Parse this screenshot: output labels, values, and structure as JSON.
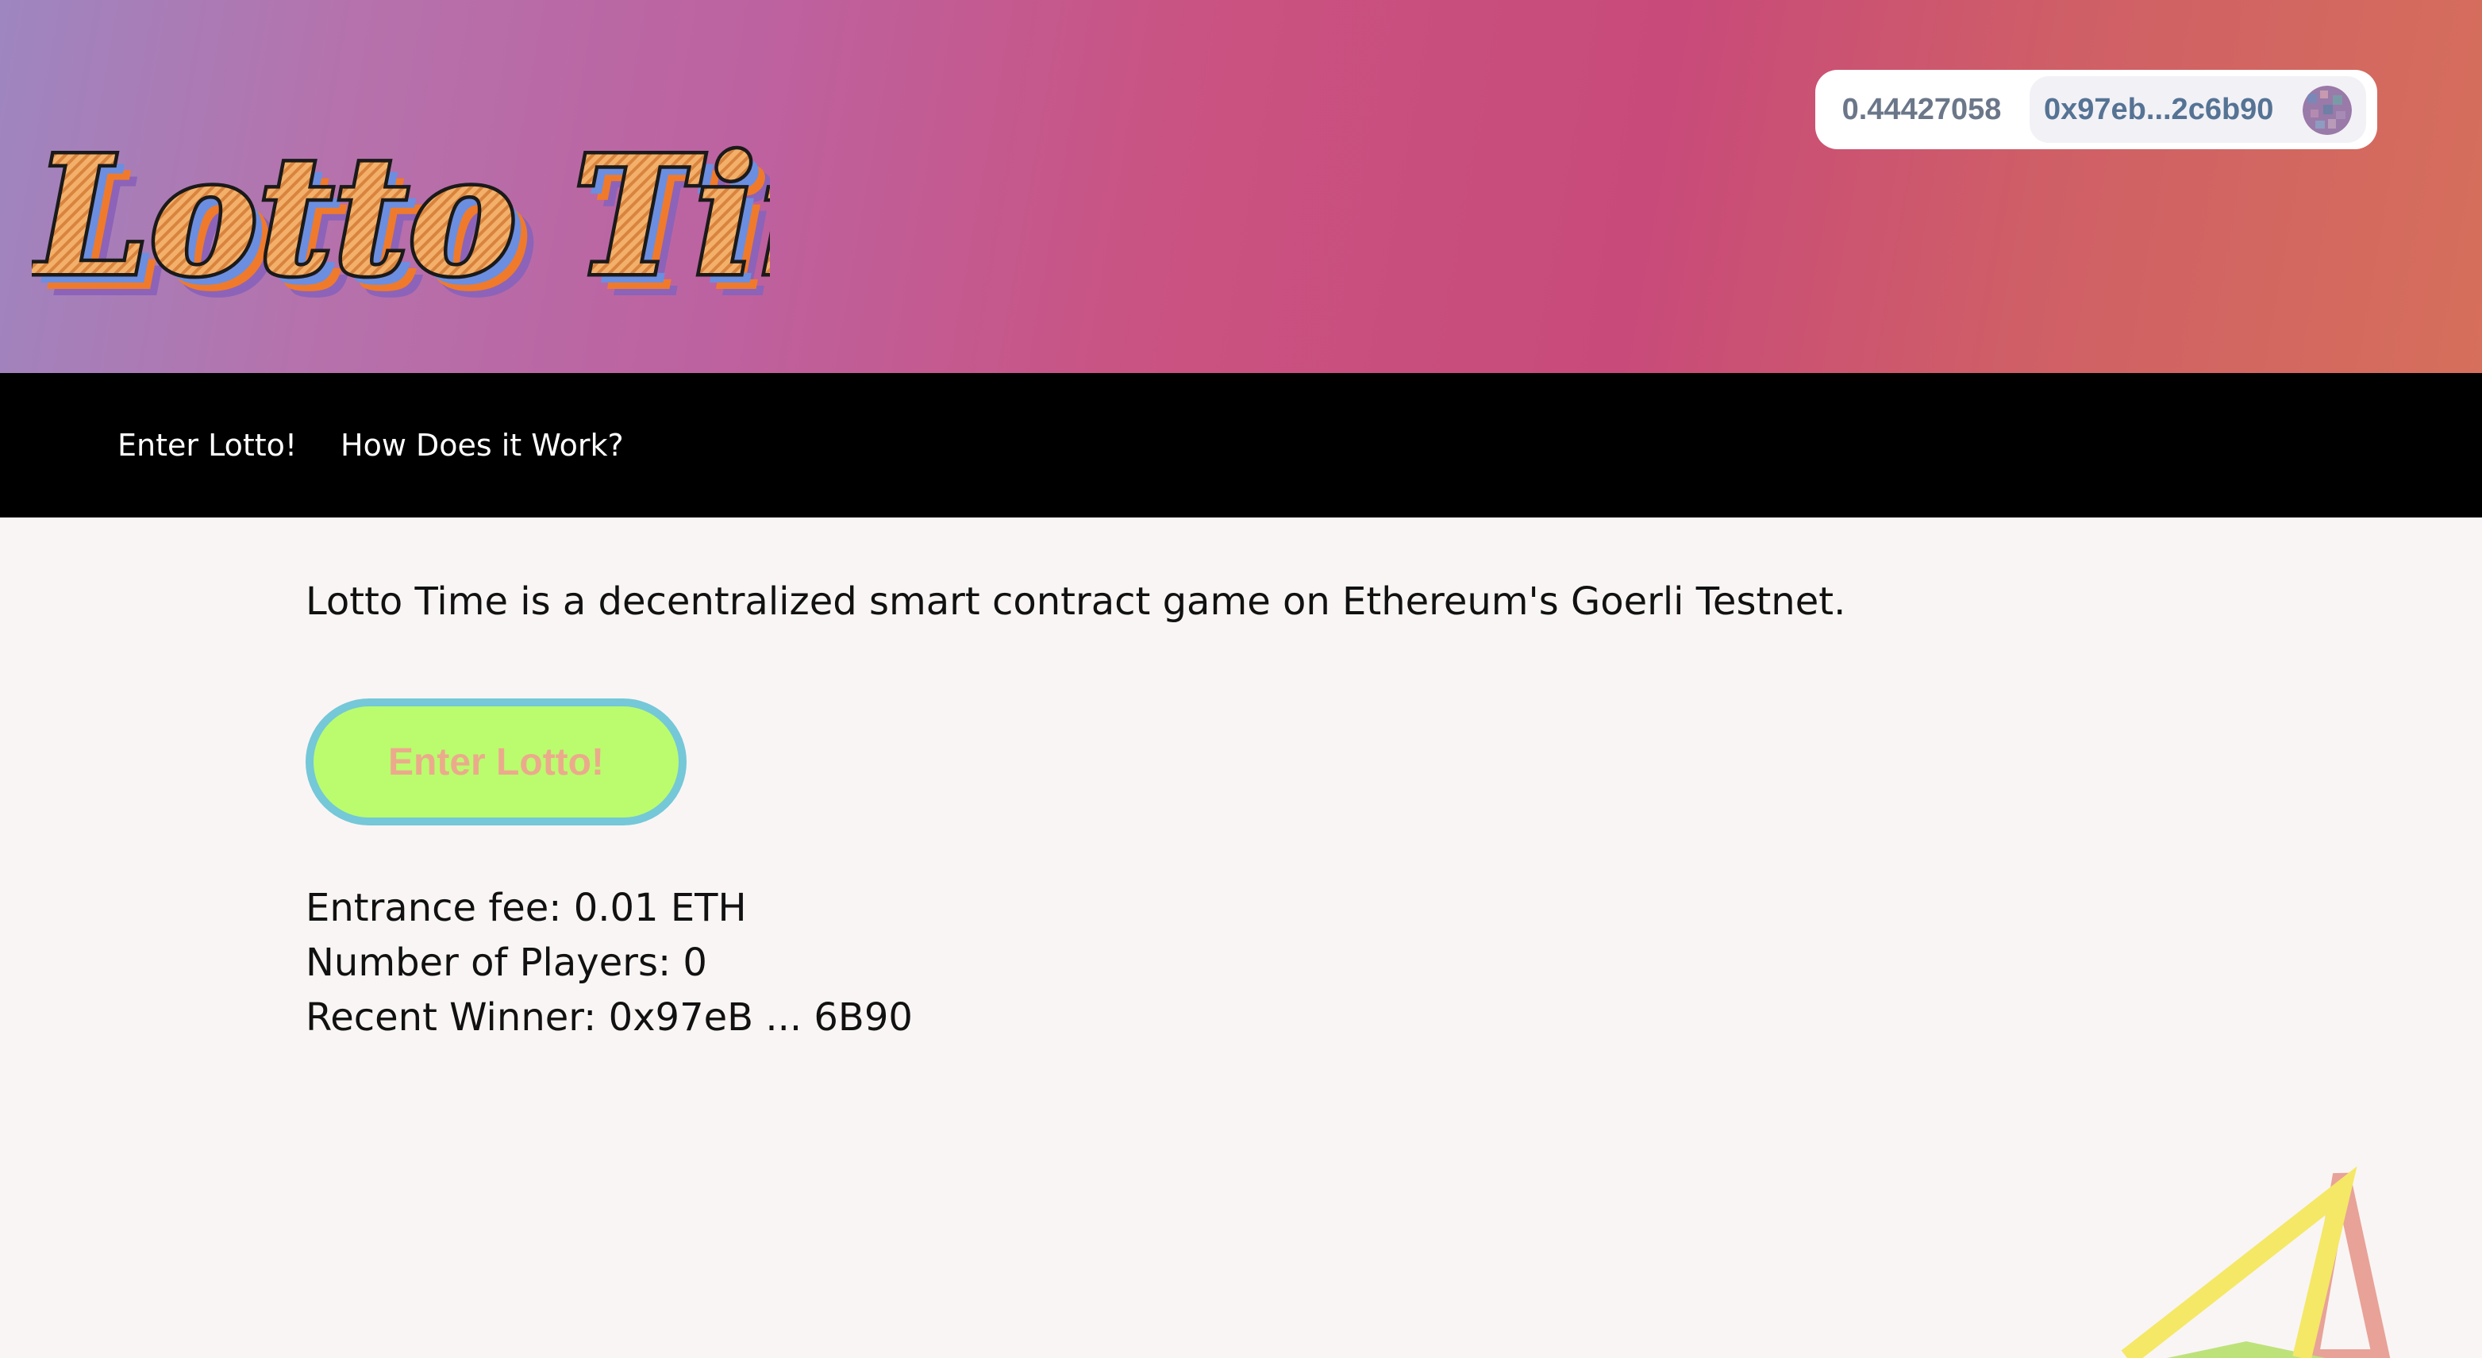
{
  "header": {
    "logo_text": "Lotto Time!",
    "wallet": {
      "balance": "0.44427058",
      "address": "0x97eb...2c6b90"
    }
  },
  "nav": {
    "items": [
      {
        "label": "Enter Lotto!"
      },
      {
        "label": "How Does it Work?"
      }
    ]
  },
  "main": {
    "intro": "Lotto Time is a decentralized smart contract game on Ethereum's Goerli Testnet.",
    "enter_button_label": "Enter Lotto!",
    "stats": {
      "entrance_fee": "Entrance fee: 0.01 ETH",
      "players": "Number of Players: 0",
      "recent_winner": "Recent Winner: 0x97eB ... 6B90"
    }
  },
  "colors": {
    "header_gradient_start": "#9e86c0",
    "header_gradient_mid": "#c84a7a",
    "header_gradient_end": "#d66f5b",
    "nav_background": "#000000",
    "page_background": "#f9f5f4",
    "button_fill": "#bafc6e",
    "button_border": "#74c8d8",
    "button_text": "#ecaa8c"
  }
}
